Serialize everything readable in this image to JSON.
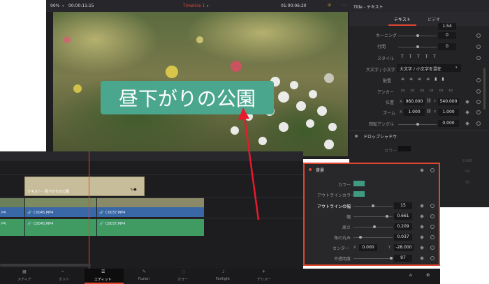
{
  "viewer": {
    "zoom": "90%",
    "timecode_left": "00:00:11:15",
    "timeline_name": "Timeline 1",
    "timecode_right": "01:00:06:20",
    "overlay_text": "昼下がりの公園"
  },
  "inspector": {
    "title": "Title - テキスト",
    "tabs": [
      "テキスト",
      "ビデオ"
    ],
    "top_value": "1.54",
    "rows": [
      {
        "label": "カーニング",
        "value": "0"
      },
      {
        "label": "行間",
        "value": "0"
      },
      {
        "label": "スタイル",
        "value": ""
      },
      {
        "label": "大文字 / 小文字",
        "value": "大文字 / 小文字を混在"
      },
      {
        "label": "配置",
        "value": ""
      },
      {
        "label": "アンカー",
        "value": ""
      },
      {
        "label": "位置",
        "x_label": "X",
        "x": "960.000",
        "y_label": "Y",
        "y": "540.000"
      },
      {
        "label": "ズーム",
        "x_label": "X",
        "x": "1.000",
        "y_label": "Y",
        "y": "1.000"
      },
      {
        "label": "回転アングル",
        "value": "0.000"
      }
    ],
    "drop_shadow": "ドロップシャドウ",
    "shadow_color_label": "カラー",
    "shadow_ghost": [
      "8.000",
      "54",
      "93"
    ]
  },
  "timeline": {
    "title_clip": "テキスト - 昼下がりの公園",
    "video_clips": [
      "P4",
      "C0045.MP4",
      "C0037.MP4"
    ],
    "audio_clips": [
      "P4",
      "C0045.MP4",
      "C0037.MP4"
    ]
  },
  "background_panel": {
    "title": "背景",
    "rows": [
      {
        "label": "カラー",
        "type": "swatch"
      },
      {
        "label": "アウトラインカラー",
        "type": "swatch"
      },
      {
        "label": "アウトラインの幅",
        "value": "15",
        "fill": 0.15
      },
      {
        "label": "幅",
        "value": "0.661",
        "fill": 0.661
      },
      {
        "label": "高さ",
        "value": "0.209",
        "fill": 0.209
      },
      {
        "label": "角の丸み",
        "value": "0.037",
        "fill": 0.1
      },
      {
        "label": "センター",
        "x_label": "X",
        "x": "0.000",
        "y_label": "Y",
        "y": "-28.000"
      },
      {
        "label": "不透明度",
        "value": "97",
        "fill": 0.97
      }
    ],
    "swatch_color": "#3f9a80"
  },
  "bottombar": {
    "items": [
      "メディア",
      "カット",
      "エディット",
      "Fusion",
      "カラー",
      "Fairlight",
      "デリバー"
    ],
    "active": "エディット"
  },
  "colors": {
    "title_bg": "#4aa68c",
    "accent_red": "#e0462f",
    "clip_blue": "#3a67a6",
    "clip_green": "#3f9b62",
    "title_clip": "#c8bd9a"
  }
}
